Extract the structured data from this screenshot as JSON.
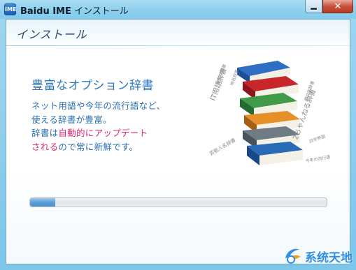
{
  "window": {
    "title_brand": "Baidu IME",
    "title_rest": " インストール",
    "icon": "baidu-ime-app-icon",
    "icon_text": "IME",
    "minimize_icon": "minimize-icon",
    "close_icon": "close-icon",
    "close_glyph": "✕"
  },
  "page": {
    "heading": "インストール"
  },
  "feature": {
    "title": "豊富なオプション辞書",
    "desc_line1": "ネット用語や今年の流行語など、",
    "desc_line2": "使える辞書が豊富。",
    "desc_line3_a": "辞書は",
    "desc_line3_b": "自動的にアップデート",
    "desc_line4_a": "される",
    "desc_line4_b": "ので常に新鮮です。"
  },
  "illustration": {
    "icon": "book-stack-icon",
    "labels": {
      "it": "IT用語辞書",
      "net": "2ちゃんねる辞書",
      "celebrity": "芸能人名辞書",
      "small": "顔文字辞書",
      "idiom": "四字熟語",
      "trend": "今年の流行語",
      "place": "地名辞書",
      "emoji": "絵文字辞書"
    }
  },
  "progress": {
    "fraction": 0.085
  },
  "watermark": {
    "text": "系统天地",
    "icon": "watermark-logo-icon"
  },
  "colors": {
    "frame": "#8ccfee",
    "accent_blue": "#2b78bd",
    "highlight_pink": "#e0246f",
    "progress_fill": "#5c9ed6"
  }
}
